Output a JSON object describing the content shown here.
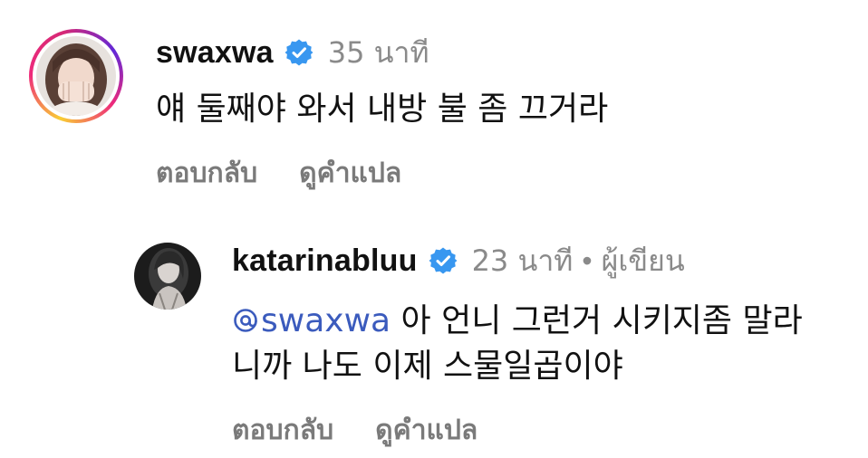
{
  "comment": {
    "username": "swaxwa",
    "verified_icon": "verified-badge-icon",
    "time": "35 นาที",
    "text": "얘 둘째야 와서 내방 불 좀 끄거라",
    "actions": {
      "reply": "ตอบกลับ",
      "translate": "ดูคำแปล"
    }
  },
  "reply": {
    "username": "katarinabluu",
    "verified_icon": "verified-badge-icon",
    "time": "23 นาที",
    "separator": "•",
    "author_tag": "ผู้เขียน",
    "mention_icon": "threads-at-icon",
    "mention": "swaxwa",
    "text_line1": " 아 언니 그런거 시키지좀 말라",
    "text_line2": "니까 나도 이제 스물일곱이야",
    "actions": {
      "reply": "ตอบกลับ",
      "translate": "ดูคำแปล"
    }
  },
  "colors": {
    "verified_blue": "#3897f0",
    "mention_blue": "#3b5bbd",
    "meta_gray": "#8a8a8a",
    "action_gray": "#7a7a7a"
  }
}
